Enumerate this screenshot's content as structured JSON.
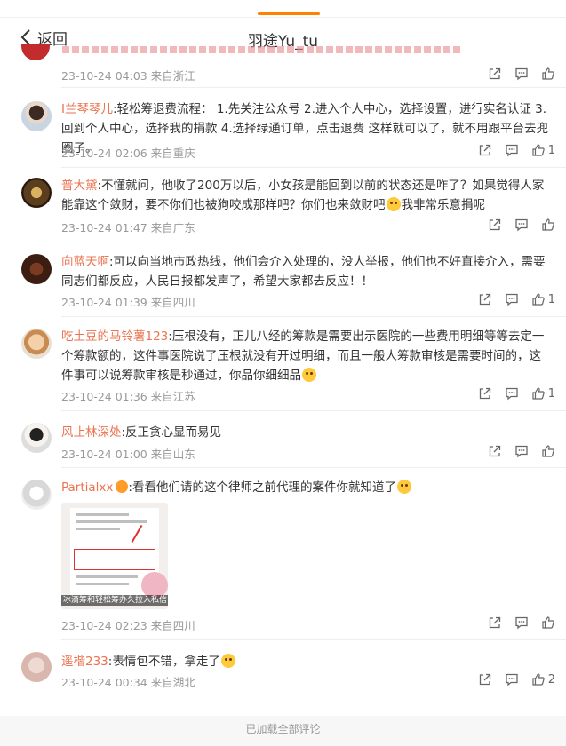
{
  "header": {
    "back_label": "返回",
    "title": "羽途Yu_tu"
  },
  "comments": [
    {
      "time": "23-10-24 04:03",
      "location": "来自浙江",
      "like_count": ""
    },
    {
      "user": "I兰琴琴儿",
      "text": ":轻松筹退费流程： 1.先关注公众号 2.进入个人中心，选择设置，进行实名认证 3.回到个人中心，选择我的捐款 4.选择绿通订单，点击退费 这样就可以了，就不用跟平台去兜圈子。",
      "time": "23-10-24 02:06",
      "location": "来自重庆",
      "like_count": "1"
    },
    {
      "user": "普大黛",
      "text_a": ":不懂就问，他收了200万以后，小女孩是能回到以前的状态还是咋了？如果觉得人家能靠这个敛财，要不你们也被狗咬成那样吧？你们也来敛财吧",
      "text_b": "我非常乐意捐呢",
      "time": "23-10-24 01:47",
      "location": "来自广东",
      "like_count": ""
    },
    {
      "user": "向蓝天啊",
      "text": ":可以向当地市政热线，他们会介入处理的，没人举报，他们也不好直接介入，需要同志们都反应，人民日报都发声了，希望大家都去反应！！",
      "time": "23-10-24 01:39",
      "location": "来自四川",
      "like_count": "1"
    },
    {
      "user": "吃土豆的马铃薯123",
      "text": ":压根没有，正儿八经的筹款是需要出示医院的一些费用明细等等去定一个筹款额的，这件事医院说了压根就没有开过明细，而且一般人筹款审核是需要时间的，这件事可以说筹款审核是秒通过，你品你细细品",
      "time": "23-10-24 01:36",
      "location": "来自江苏",
      "like_count": "1"
    },
    {
      "user": "风止林深处",
      "text": ":反正贪心显而易见",
      "time": "23-10-24 01:00",
      "location": "来自山东",
      "like_count": ""
    },
    {
      "user": "Partialxx",
      "text": ":看看他们请的这个律师之前代理的案件你就知道了",
      "image_caption": "冰滴筹和轻松筹办久拉入私信",
      "time": "23-10-24 02:23",
      "location": "来自四川",
      "like_count": ""
    },
    {
      "user": "遥楷233",
      "text": ":表情包不错，拿走了",
      "time": "23-10-24 00:34",
      "location": "来自湖北",
      "like_count": "2"
    }
  ],
  "footer": {
    "text": "已加载全部评论"
  },
  "colors": {
    "accent": "#ff8200",
    "username": "#eb7350",
    "meta": "#999999"
  }
}
